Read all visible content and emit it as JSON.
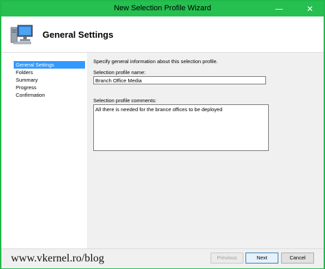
{
  "window": {
    "title": "New Selection Profile Wizard",
    "minimize_glyph": "—",
    "close_glyph": "✕"
  },
  "header": {
    "title": "General Settings",
    "icon": "computer-monitor-icon"
  },
  "nav": {
    "items": [
      {
        "label": "General Settings",
        "active": true
      },
      {
        "label": "Folders",
        "active": false
      },
      {
        "label": "Summary",
        "active": false
      },
      {
        "label": "Progress",
        "active": false
      },
      {
        "label": "Confirmation",
        "active": false
      }
    ]
  },
  "content": {
    "description": "Specify general information about this selection profile.",
    "name_label": "Selection profile name:",
    "name_value": "Branch Office Media",
    "comments_label": "Selection profile comments:",
    "comments_value": "All there is needed for the brance offices to be deployed"
  },
  "footer": {
    "watermark": "www.vkernel.ro/blog",
    "previous_label": "Previous",
    "next_label": "Next",
    "cancel_label": "Cancel"
  },
  "colors": {
    "titlebar": "#25c050",
    "nav_active": "#3399ff"
  }
}
